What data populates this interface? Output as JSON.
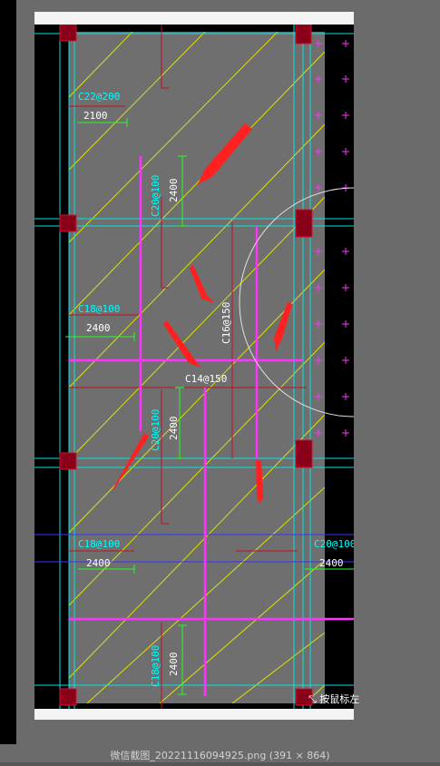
{
  "image_viewer": {
    "caption": "微信截图_20221116094925.png (391 × 864)"
  },
  "drawing": {
    "rebar_labels": [
      {
        "id": "l1",
        "code": "C22@200",
        "length": "2100"
      },
      {
        "id": "l2",
        "code": "C20@100",
        "length": "2400"
      },
      {
        "id": "l3",
        "code": "C18@100",
        "length": "2400"
      },
      {
        "id": "l4",
        "code": "C16@150"
      },
      {
        "id": "l5",
        "code": "C14@150"
      },
      {
        "id": "l6",
        "code": "C20@100",
        "length": "2400"
      },
      {
        "id": "l7",
        "code": "C18@100",
        "length": "2400"
      },
      {
        "id": "l8",
        "code": "C20@100",
        "length": "2400"
      },
      {
        "id": "l9",
        "code": "C18@100",
        "length": "2400"
      }
    ],
    "cursor_hint": "按鼠标左"
  },
  "colors": {
    "background": "#6b6b6b",
    "cad_black": "#000000",
    "slab_gray": "#6f6f6f",
    "rebar_cyan": "#00ffff",
    "rebar_magenta": "#ff33ff",
    "hatch_yellow": "#e0e000",
    "dim_green": "#22ff22",
    "column_red": "#8a0018",
    "annotation_arrow": "#ff2020"
  }
}
